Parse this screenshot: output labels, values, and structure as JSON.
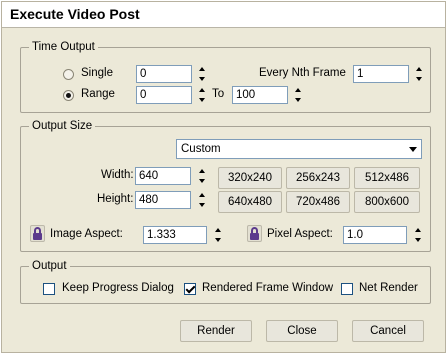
{
  "window": {
    "title": "Execute Video Post"
  },
  "time_output": {
    "legend": "Time Output",
    "single": {
      "label": "Single",
      "value": "0",
      "selected": false
    },
    "range": {
      "label": "Range",
      "from": "0",
      "to_label": "To",
      "to": "100",
      "selected": true
    },
    "every_nth": {
      "label": "Every Nth Frame",
      "value": "1"
    }
  },
  "output_size": {
    "legend": "Output Size",
    "preset": "Custom",
    "width": {
      "label": "Width:",
      "value": "640"
    },
    "height": {
      "label": "Height:",
      "value": "480"
    },
    "presets": [
      "320x240",
      "256x243",
      "512x486",
      "640x480",
      "720x486",
      "800x600"
    ],
    "image_aspect": {
      "label": "Image Aspect:",
      "value": "1.333"
    },
    "pixel_aspect": {
      "label": "Pixel Aspect:",
      "value": "1.0"
    }
  },
  "output": {
    "legend": "Output",
    "keep_progress": {
      "label": "Keep Progress Dialog",
      "checked": false
    },
    "rendered_frame": {
      "label": "Rendered Frame Window",
      "checked": true
    },
    "net_render": {
      "label": "Net Render",
      "checked": false
    }
  },
  "buttons": {
    "render": "Render",
    "close": "Close",
    "cancel": "Cancel"
  },
  "colors": {
    "dialog_bg": "#ece9d8",
    "field_border": "#7f9db9",
    "lock_color": "#5b3a8c"
  }
}
